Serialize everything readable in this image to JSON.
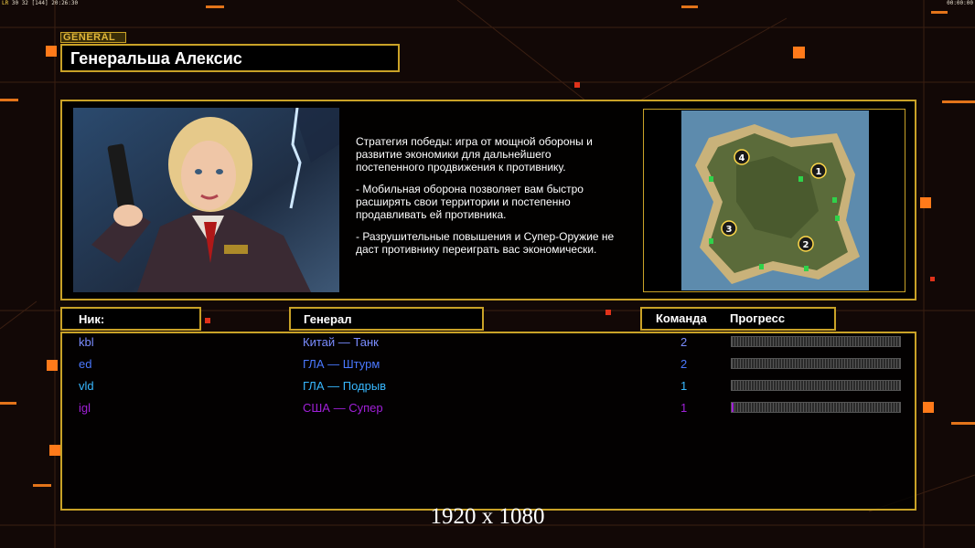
{
  "hud": {
    "fps_prefix": "LR",
    "fps_values": "30 32",
    "fps_extra": "[144]",
    "clock_left": "20:26:30",
    "clock_right": "00:00:00"
  },
  "header": {
    "tag": "GENERAL",
    "title": "Генеральша Алексис"
  },
  "info": {
    "paragraphs": [
      "Стратегия победы: игра от мощной обороны и\n развитие экономики для дальнейшего\n постепенного продвижения к противнику.",
      "- Мобильная оборона позволяет вам быстро\n расширять свои территории и постепенно\n продавливать ей противника.",
      "- Разрушительные повышения и Супер-Оружие не\n даст противнику переиграть вас экономически."
    ]
  },
  "map": {
    "start_positions": [
      "1",
      "2",
      "3",
      "4"
    ]
  },
  "table": {
    "headers": {
      "nick": "Ник:",
      "general": "Генерал",
      "team": "Команда",
      "progress": "Прогресс"
    },
    "rows": [
      {
        "nick": "kbl",
        "general": "Китай — Танк",
        "team": "2",
        "progress": 0.0,
        "color": "#7a8cff"
      },
      {
        "nick": "ed",
        "general": "ГЛА — Штурм",
        "team": "2",
        "progress": 0.0,
        "color": "#4a78ff"
      },
      {
        "nick": "vld",
        "general": "ГЛА — Подрыв",
        "team": "1",
        "progress": 0.0,
        "color": "#38b8ff"
      },
      {
        "nick": "igl",
        "general": "США — Супер",
        "team": "1",
        "progress": 0.01,
        "color": "#a020d8"
      }
    ]
  },
  "resolution_label": "1920 x 1080",
  "colors": {
    "frame": "#c9a227",
    "background": "#120806",
    "accent": "#ff7a1a"
  }
}
